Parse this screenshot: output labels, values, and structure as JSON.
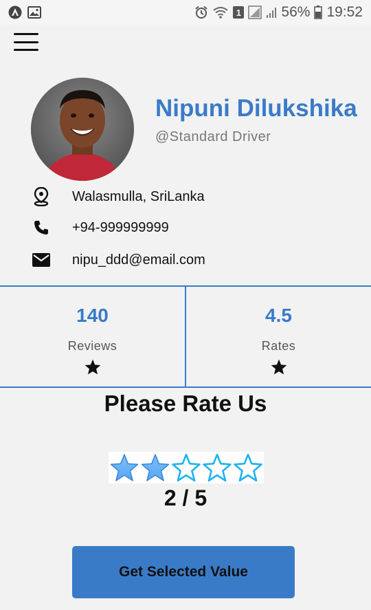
{
  "status_bar": {
    "sim_badge": "1",
    "battery": "56%",
    "time": "19:52"
  },
  "profile": {
    "name": "Nipuni Dilukshika",
    "role": "@Standard Driver",
    "location": "Walasmulla, SriLanka",
    "phone": "+94-999999999",
    "email": "nipu_ddd@email.com"
  },
  "stats": [
    {
      "value": "140",
      "label": "Reviews"
    },
    {
      "value": "4.5",
      "label": "Rates"
    }
  ],
  "rating": {
    "title": "Please Rate Us",
    "selected": 2,
    "max": 5,
    "display": "2 / 5"
  },
  "actions": {
    "get_selected_label": "Get Selected Value"
  },
  "colors": {
    "accent": "#3a7bc8",
    "star_filled": "#5aa6ef",
    "star_outline": "#1fb3f0"
  }
}
